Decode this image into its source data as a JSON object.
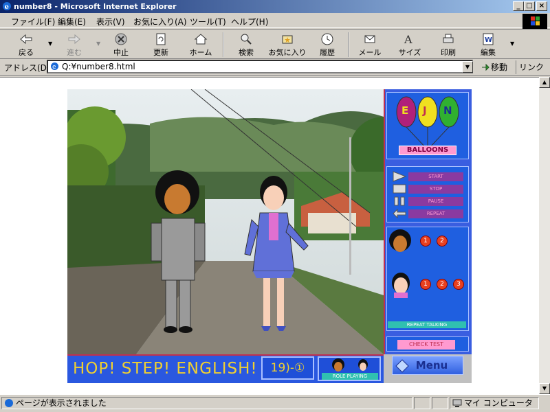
{
  "window": {
    "title": "number8 - Microsoft Internet Explorer",
    "min_label": "_",
    "max_label": "□",
    "close_label": "×"
  },
  "menu": [
    "ファイル(F)",
    "編集(E)",
    "表示(V)",
    "お気に入り(A)",
    "ツール(T)",
    "ヘルプ(H)"
  ],
  "toolbar": {
    "back": "戻る",
    "forward": "進む",
    "stop": "中止",
    "refresh": "更新",
    "home": "ホーム",
    "search": "検索",
    "favorites": "お気に入り",
    "history": "履歴",
    "mail": "メール",
    "size": "サイズ",
    "print": "印刷",
    "edit": "編集"
  },
  "address": {
    "label": "アドレス(D)",
    "value": "Q:¥number8.html",
    "go": "移動",
    "links": "リンク"
  },
  "page": {
    "title": "HOP! STEP! ENGLISH!",
    "lesson": "19)-①",
    "role_playing": "ROLE PLAYING",
    "balloons": {
      "label": "BALLOONS",
      "letters": [
        "E",
        "J",
        "N"
      ],
      "colors": [
        "#b0207a",
        "#f0e020",
        "#30b030"
      ]
    },
    "controls": [
      "START",
      "STOP",
      "PAUSE",
      "REPEAT"
    ],
    "talking": {
      "boy_numbers": [
        "1",
        "2"
      ],
      "girl_numbers": [
        "1",
        "2",
        "3"
      ],
      "label": "REPEAT TALKING"
    },
    "check_test": "CHECK TEST",
    "menu_button": "Menu"
  },
  "status": {
    "message": "ページが表示されました",
    "zone": "マイ コンピュータ"
  },
  "colors": {
    "sidebar": "#3a5ee0",
    "accent_title": "#f0d030",
    "border_accent": "#c03050"
  }
}
